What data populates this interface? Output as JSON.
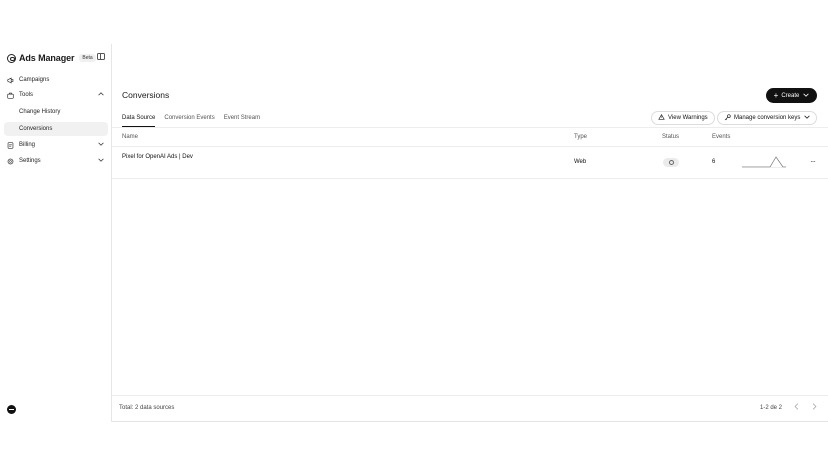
{
  "sidebar": {
    "brand": "Ads Manager",
    "badge": "Beta",
    "items": [
      {
        "label": "Campaigns",
        "icon": "megaphone-icon"
      },
      {
        "label": "Tools",
        "icon": "briefcase-icon"
      },
      {
        "label": "Change History"
      },
      {
        "label": "Conversions"
      },
      {
        "label": "Billing",
        "icon": "receipt-icon"
      },
      {
        "label": "Settings",
        "icon": "gear-icon"
      }
    ]
  },
  "main": {
    "title": "Conversions",
    "create_label": "Create",
    "tabs": [
      "Data Source",
      "Conversion Events",
      "Event Stream"
    ],
    "view_warnings_label": "View Warnings",
    "manage_keys_label": "Manage conversion keys",
    "columns": [
      "Name",
      "Type",
      "Status",
      "Events"
    ],
    "rows": [
      {
        "name": "Pixel for OpenAI Ads | Dev",
        "type": "Web",
        "events": "6"
      }
    ],
    "footer_total": "Total: 2 data sources",
    "pagination": "1-2 de 2"
  }
}
